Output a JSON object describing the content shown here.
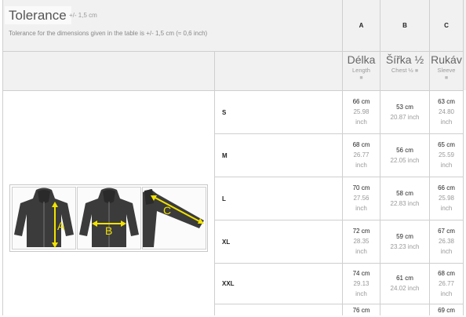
{
  "tolerance": {
    "title": "Tolerance",
    "ghost": "+/- 1,5 cm",
    "description": "Tolerance for the dimensions given in the table is +/- 1,5 cm (≈ 0,6 inch)"
  },
  "columns": [
    {
      "key": "A",
      "label": "Délka",
      "sub": "Length",
      "sq": "■"
    },
    {
      "key": "B",
      "label": "Šířka ½",
      "sub": "Chest ½",
      "sq": "■"
    },
    {
      "key": "C",
      "label": "Rukáv",
      "sub": "Sleeve",
      "sq": "■"
    }
  ],
  "rows": [
    {
      "size": "S",
      "a_cm": "66 cm",
      "a_in": "25.98",
      "a_u": "inch",
      "b_cm": "53 cm",
      "b_in": "20.87 inch",
      "c_cm": "63 cm",
      "c_in": "24.80",
      "c_u": "inch"
    },
    {
      "size": "M",
      "a_cm": "68 cm",
      "a_in": "26.77",
      "a_u": "inch",
      "b_cm": "56 cm",
      "b_in": "22.05 inch",
      "c_cm": "65 cm",
      "c_in": "25.59",
      "c_u": "inch"
    },
    {
      "size": "L",
      "a_cm": "70 cm",
      "a_in": "27.56",
      "a_u": "inch",
      "b_cm": "58 cm",
      "b_in": "22.83 inch",
      "c_cm": "66 cm",
      "c_in": "25.98",
      "c_u": "inch"
    },
    {
      "size": "XL",
      "a_cm": "72 cm",
      "a_in": "28.35",
      "a_u": "inch",
      "b_cm": "59 cm",
      "b_in": "23.23 inch",
      "c_cm": "67 cm",
      "c_in": "26.38",
      "c_u": "inch"
    },
    {
      "size": "XXL",
      "a_cm": "74 cm",
      "a_in": "29.13",
      "a_u": "inch",
      "b_cm": "61 cm",
      "b_in": "24.02 inch",
      "c_cm": "68 cm",
      "c_in": "26.77",
      "c_u": "inch"
    },
    {
      "size": "",
      "a_cm": "76 cm",
      "a_in": "",
      "a_u": "",
      "b_cm": "",
      "b_in": "",
      "c_cm": "69 cm",
      "c_in": "",
      "c_u": ""
    }
  ],
  "diagram": {
    "labels": [
      "A",
      "B",
      "C"
    ],
    "arrow_color": "#f2e200"
  }
}
